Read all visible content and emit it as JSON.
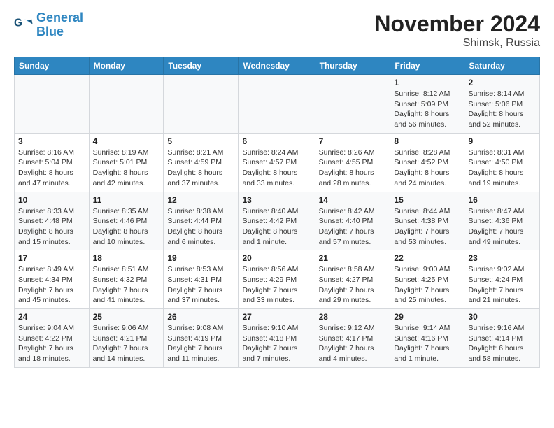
{
  "logo": {
    "text1": "General",
    "text2": "Blue"
  },
  "title": "November 2024",
  "subtitle": "Shimsk, Russia",
  "days_of_week": [
    "Sunday",
    "Monday",
    "Tuesday",
    "Wednesday",
    "Thursday",
    "Friday",
    "Saturday"
  ],
  "weeks": [
    [
      {
        "day": "",
        "info": ""
      },
      {
        "day": "",
        "info": ""
      },
      {
        "day": "",
        "info": ""
      },
      {
        "day": "",
        "info": ""
      },
      {
        "day": "",
        "info": ""
      },
      {
        "day": "1",
        "info": "Sunrise: 8:12 AM\nSunset: 5:09 PM\nDaylight: 8 hours and 56 minutes."
      },
      {
        "day": "2",
        "info": "Sunrise: 8:14 AM\nSunset: 5:06 PM\nDaylight: 8 hours and 52 minutes."
      }
    ],
    [
      {
        "day": "3",
        "info": "Sunrise: 8:16 AM\nSunset: 5:04 PM\nDaylight: 8 hours and 47 minutes."
      },
      {
        "day": "4",
        "info": "Sunrise: 8:19 AM\nSunset: 5:01 PM\nDaylight: 8 hours and 42 minutes."
      },
      {
        "day": "5",
        "info": "Sunrise: 8:21 AM\nSunset: 4:59 PM\nDaylight: 8 hours and 37 minutes."
      },
      {
        "day": "6",
        "info": "Sunrise: 8:24 AM\nSunset: 4:57 PM\nDaylight: 8 hours and 33 minutes."
      },
      {
        "day": "7",
        "info": "Sunrise: 8:26 AM\nSunset: 4:55 PM\nDaylight: 8 hours and 28 minutes."
      },
      {
        "day": "8",
        "info": "Sunrise: 8:28 AM\nSunset: 4:52 PM\nDaylight: 8 hours and 24 minutes."
      },
      {
        "day": "9",
        "info": "Sunrise: 8:31 AM\nSunset: 4:50 PM\nDaylight: 8 hours and 19 minutes."
      }
    ],
    [
      {
        "day": "10",
        "info": "Sunrise: 8:33 AM\nSunset: 4:48 PM\nDaylight: 8 hours and 15 minutes."
      },
      {
        "day": "11",
        "info": "Sunrise: 8:35 AM\nSunset: 4:46 PM\nDaylight: 8 hours and 10 minutes."
      },
      {
        "day": "12",
        "info": "Sunrise: 8:38 AM\nSunset: 4:44 PM\nDaylight: 8 hours and 6 minutes."
      },
      {
        "day": "13",
        "info": "Sunrise: 8:40 AM\nSunset: 4:42 PM\nDaylight: 8 hours and 1 minute."
      },
      {
        "day": "14",
        "info": "Sunrise: 8:42 AM\nSunset: 4:40 PM\nDaylight: 7 hours and 57 minutes."
      },
      {
        "day": "15",
        "info": "Sunrise: 8:44 AM\nSunset: 4:38 PM\nDaylight: 7 hours and 53 minutes."
      },
      {
        "day": "16",
        "info": "Sunrise: 8:47 AM\nSunset: 4:36 PM\nDaylight: 7 hours and 49 minutes."
      }
    ],
    [
      {
        "day": "17",
        "info": "Sunrise: 8:49 AM\nSunset: 4:34 PM\nDaylight: 7 hours and 45 minutes."
      },
      {
        "day": "18",
        "info": "Sunrise: 8:51 AM\nSunset: 4:32 PM\nDaylight: 7 hours and 41 minutes."
      },
      {
        "day": "19",
        "info": "Sunrise: 8:53 AM\nSunset: 4:31 PM\nDaylight: 7 hours and 37 minutes."
      },
      {
        "day": "20",
        "info": "Sunrise: 8:56 AM\nSunset: 4:29 PM\nDaylight: 7 hours and 33 minutes."
      },
      {
        "day": "21",
        "info": "Sunrise: 8:58 AM\nSunset: 4:27 PM\nDaylight: 7 hours and 29 minutes."
      },
      {
        "day": "22",
        "info": "Sunrise: 9:00 AM\nSunset: 4:25 PM\nDaylight: 7 hours and 25 minutes."
      },
      {
        "day": "23",
        "info": "Sunrise: 9:02 AM\nSunset: 4:24 PM\nDaylight: 7 hours and 21 minutes."
      }
    ],
    [
      {
        "day": "24",
        "info": "Sunrise: 9:04 AM\nSunset: 4:22 PM\nDaylight: 7 hours and 18 minutes."
      },
      {
        "day": "25",
        "info": "Sunrise: 9:06 AM\nSunset: 4:21 PM\nDaylight: 7 hours and 14 minutes."
      },
      {
        "day": "26",
        "info": "Sunrise: 9:08 AM\nSunset: 4:19 PM\nDaylight: 7 hours and 11 minutes."
      },
      {
        "day": "27",
        "info": "Sunrise: 9:10 AM\nSunset: 4:18 PM\nDaylight: 7 hours and 7 minutes."
      },
      {
        "day": "28",
        "info": "Sunrise: 9:12 AM\nSunset: 4:17 PM\nDaylight: 7 hours and 4 minutes."
      },
      {
        "day": "29",
        "info": "Sunrise: 9:14 AM\nSunset: 4:16 PM\nDaylight: 7 hours and 1 minute."
      },
      {
        "day": "30",
        "info": "Sunrise: 9:16 AM\nSunset: 4:14 PM\nDaylight: 6 hours and 58 minutes."
      }
    ]
  ]
}
